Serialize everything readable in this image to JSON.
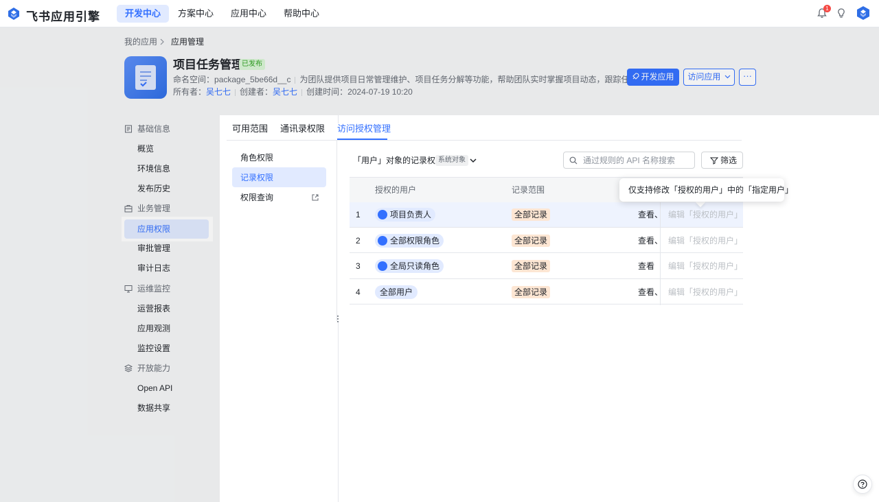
{
  "topbar": {
    "logo_text": "飞书应用引擎",
    "nav": [
      "开发中心",
      "方案中心",
      "应用中心",
      "帮助中心"
    ],
    "active_nav": "开发中心",
    "notification_count": "1"
  },
  "breadcrumb": {
    "parent": "我的应用",
    "current": "应用管理"
  },
  "app": {
    "title": "项目任务管理",
    "status": "已发布",
    "namespace_label": "命名空间：",
    "namespace": "package_5be66d__c",
    "description": "为团队提供项目日常管理维护、项目任务分解等功能，帮助团队实时掌握项目动态，跟踪任务进度",
    "owner_label": "所有者：",
    "owner": "吴七七",
    "creator_label": "创建者：",
    "creator": "吴七七",
    "created_label": "创建时间：",
    "created": "2024-07-19 10:20"
  },
  "actions": {
    "dev": "开发应用",
    "visit": "访问应用",
    "more": "···"
  },
  "sidebar": {
    "groups": [
      {
        "label": "基础信息",
        "icon": "doc-icon",
        "items": [
          "概览",
          "环境信息",
          "发布历史"
        ]
      },
      {
        "label": "业务管理",
        "icon": "briefcase-icon",
        "items": [
          "应用权限",
          "审批管理",
          "审计日志"
        ]
      },
      {
        "label": "运维监控",
        "icon": "monitor-icon",
        "items": [
          "运营报表",
          "应用观测",
          "监控设置"
        ]
      },
      {
        "label": "开放能力",
        "icon": "layers-icon",
        "items": [
          "Open API",
          "数据共享"
        ]
      }
    ],
    "active_item": "应用权限"
  },
  "panel": {
    "tabs": [
      "可用范围",
      "通讯录权限",
      "访问授权管理"
    ],
    "active_tab": "访问授权管理",
    "side_items": [
      "角色权限",
      "记录权限",
      "权限查询"
    ],
    "active_side": "记录权限",
    "object_title": "「用户」对象的记录权限",
    "object_tag": "系统对象",
    "search_placeholder": "通过规则的 API 名称搜索",
    "filter_label": "筛选",
    "columns": [
      "授权的用户",
      "记录范围"
    ],
    "rows": [
      {
        "index": "1",
        "user": "项目负责人",
        "has_icon": true,
        "scope": "全部记录",
        "perm": "查看、",
        "edit": "编辑「授权的用户」"
      },
      {
        "index": "2",
        "user": "全部权限角色",
        "has_icon": true,
        "scope": "全部记录",
        "perm": "查看、",
        "edit": "编辑「授权的用户」"
      },
      {
        "index": "3",
        "user": "全局只读角色",
        "has_icon": true,
        "scope": "全部记录",
        "perm": "查看",
        "edit": "编辑「授权的用户」"
      },
      {
        "index": "4",
        "user": "全部用户",
        "has_icon": false,
        "scope": "全部记录",
        "perm": "查看、",
        "edit": "编辑「授权的用户」"
      }
    ],
    "tooltip": "仅支持修改「授权的用户」中的「指定用户」"
  }
}
